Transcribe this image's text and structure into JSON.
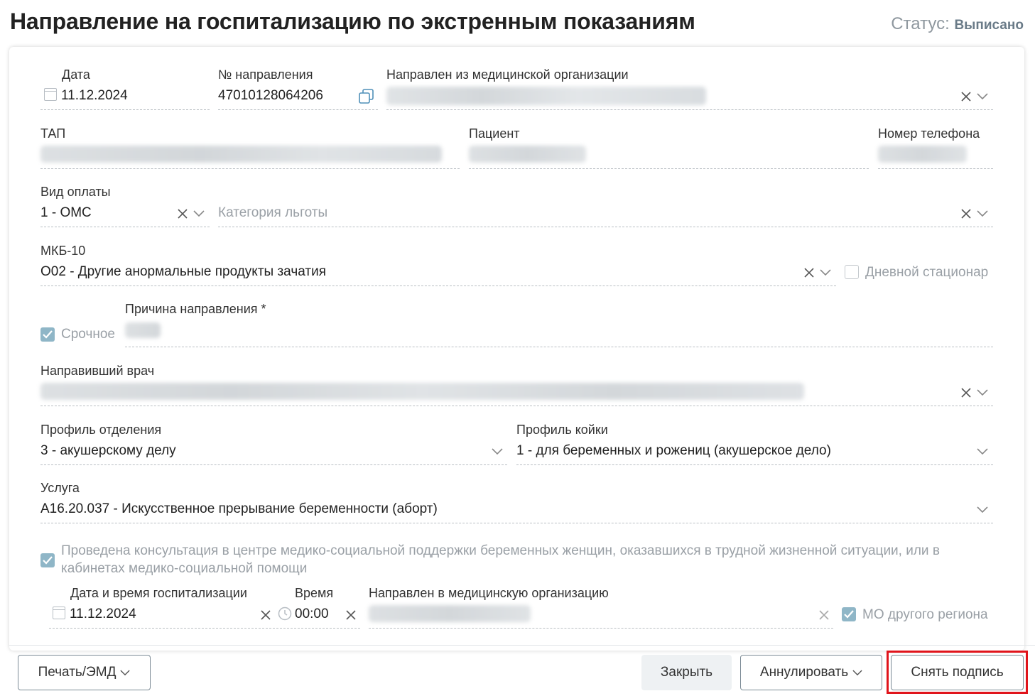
{
  "header": {
    "title": "Направление на госпитализацию по экстренным показаниям",
    "status_label": "Статус:",
    "status_value": "Выписано"
  },
  "form": {
    "date": {
      "label": "Дата",
      "value": "11.12.2024"
    },
    "referral_number": {
      "label": "№ направления",
      "value": "47010128064206"
    },
    "from_org": {
      "label": "Направлен из медицинской организации"
    },
    "tap": {
      "label": "ТАП"
    },
    "patient": {
      "label": "Пациент"
    },
    "phone": {
      "label": "Номер телефона"
    },
    "payment": {
      "label": "Вид оплаты",
      "value": "1 - ОМС"
    },
    "benefit": {
      "placeholder": "Категория льготы"
    },
    "mkb": {
      "label": "МКБ-10",
      "value": "O02 - Другие анормальные продукты зачатия"
    },
    "day_hospital": {
      "label": "Дневной стационар",
      "checked": false
    },
    "urgent": {
      "label": "Срочное",
      "checked": true
    },
    "reason": {
      "label": "Причина направления *"
    },
    "doctor": {
      "label": "Направивший врач"
    },
    "dept_profile": {
      "label": "Профиль отделения",
      "value": "3 - акушерскому делу"
    },
    "bed_profile": {
      "label": "Профиль койки",
      "value": "1 - для беременных и рожениц (акушерское дело)"
    },
    "service": {
      "label": "Услуга",
      "value": "A16.20.037 - Искусственное прерывание беременности (аборт)"
    },
    "consultation": {
      "label_line1": "Проведена консультация в центре медико-социальной поддержки беременных женщин, оказавшихся в трудной жизненной ситуации, или в",
      "label_line2": "кабинетах медико-социальной помощи",
      "checked": true
    },
    "hosp_date": {
      "label": "Дата и время госпитализации",
      "value": "11.12.2024"
    },
    "hosp_time": {
      "label": "Время",
      "value": "00:00"
    },
    "to_org": {
      "label": "Направлен в медицинскую организацию"
    },
    "other_region": {
      "label": "МО другого региона",
      "checked": true
    }
  },
  "footer": {
    "print_button": "Печать/ЭМД",
    "close_button": "Закрыть",
    "annul_button": "Аннулировать",
    "unsign_button": "Снять подпись"
  },
  "colors": {
    "checkbox_checked": "#8fb6c7",
    "status_value": "#6a7b88",
    "highlight": "#e0141b"
  }
}
